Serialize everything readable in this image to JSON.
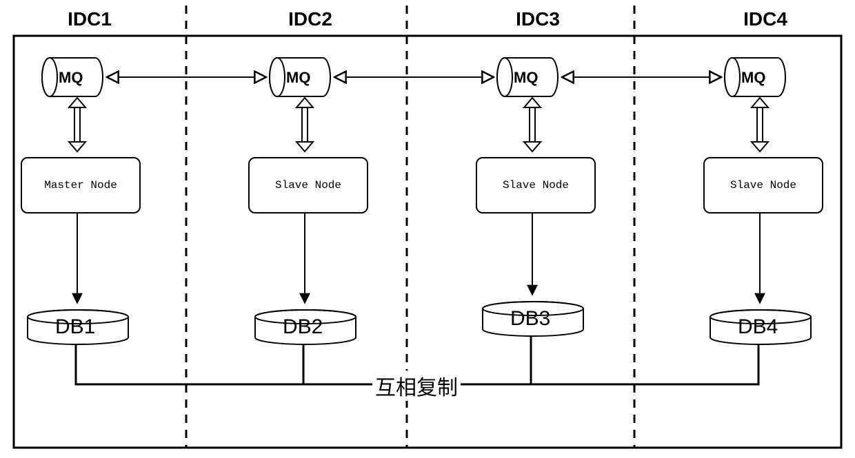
{
  "columns": [
    {
      "title": "IDC1",
      "mq": "MQ",
      "node": "Master Node",
      "db": "DB1"
    },
    {
      "title": "IDC2",
      "mq": "MQ",
      "node": "Slave Node",
      "db": "DB2"
    },
    {
      "title": "IDC3",
      "mq": "MQ",
      "node": "Slave Node",
      "db": "DB3"
    },
    {
      "title": "IDC4",
      "mq": "MQ",
      "node": "Slave Node",
      "db": "DB4"
    }
  ],
  "replication_label": "互相复制"
}
